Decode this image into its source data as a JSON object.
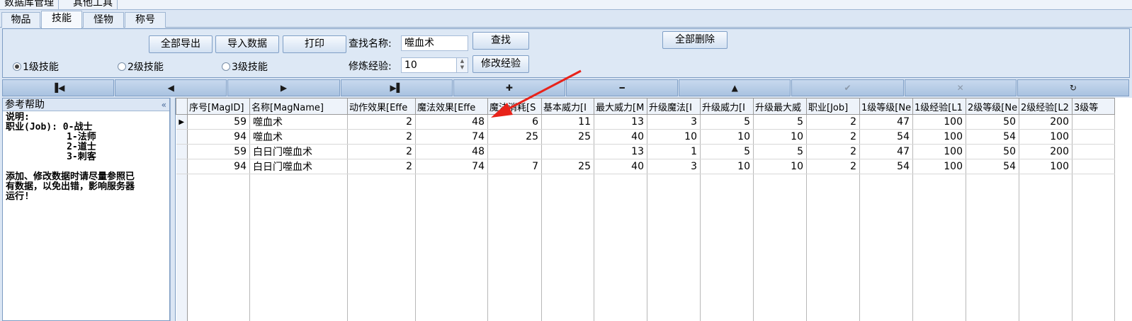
{
  "top_tabs": [
    "数据库管理",
    "其他工具"
  ],
  "tabs": [
    {
      "label": "物品",
      "active": false
    },
    {
      "label": "技能",
      "active": true
    },
    {
      "label": "怪物",
      "active": false
    },
    {
      "label": "称号",
      "active": false
    }
  ],
  "toolbar": {
    "export_all": "全部导出",
    "import_data": "导入数据",
    "print": "打印",
    "search_label": "查找名称:",
    "search_value": "噬血术",
    "search_button": "查找",
    "delete_all": "全部删除",
    "exp_label": "修炼经验:",
    "exp_value": "10",
    "modify_exp": "修改经验"
  },
  "radios": [
    {
      "label": "1级技能",
      "checked": true
    },
    {
      "label": "2级技能",
      "checked": false
    },
    {
      "label": "3级技能",
      "checked": false
    }
  ],
  "navigator": [
    {
      "icon": "first-record-icon",
      "glyph": "▐◀",
      "enabled": true
    },
    {
      "icon": "prior-record-icon",
      "glyph": "◀",
      "enabled": true
    },
    {
      "icon": "next-record-icon",
      "glyph": "▶",
      "enabled": true
    },
    {
      "icon": "last-record-icon",
      "glyph": "▶▌",
      "enabled": true
    },
    {
      "icon": "insert-record-icon",
      "glyph": "✚",
      "enabled": true
    },
    {
      "icon": "delete-record-icon",
      "glyph": "━",
      "enabled": true
    },
    {
      "icon": "edit-record-icon",
      "glyph": "▲",
      "enabled": true
    },
    {
      "icon": "post-edit-icon",
      "glyph": "✔",
      "enabled": false
    },
    {
      "icon": "cancel-edit-icon",
      "glyph": "✕",
      "enabled": false
    },
    {
      "icon": "refresh-data-icon",
      "glyph": "↻",
      "enabled": true
    }
  ],
  "help": {
    "title": "参考帮助",
    "text": "说明:\n职业(Job): 0-战士\n           1-法师\n           2-道士\n           3-刺客\n\n添加、修改数据时请尽量参照已\n有数据，以免出错，影响服务器\n运行!"
  },
  "grid": {
    "columns": [
      "序号[MagID]",
      "名称[MagName]",
      "动作效果[Effe",
      "魔法效果[Effe",
      "魔法消耗[S",
      "基本威力[I",
      "最大威力[M",
      "升级魔法[I",
      "升级威力[I",
      "升级最大威",
      "职业[Job]",
      "1级等级[Ne",
      "1级经验[L1",
      "2级等级[Ne",
      "2级经验[L2",
      "3级等"
    ],
    "rows": [
      [
        "59",
        "噬血术",
        "2",
        "48",
        "6",
        "11",
        "13",
        "3",
        "5",
        "5",
        "2",
        "47",
        "100",
        "50",
        "200",
        ""
      ],
      [
        "94",
        "噬血术",
        "2",
        "74",
        "25",
        "25",
        "40",
        "10",
        "10",
        "10",
        "2",
        "54",
        "100",
        "54",
        "100",
        ""
      ],
      [
        "59",
        "白日门噬血术",
        "2",
        "48",
        "",
        "",
        "13",
        "1",
        "5",
        "5",
        "2",
        "47",
        "100",
        "50",
        "200",
        ""
      ],
      [
        "94",
        "白日门噬血术",
        "2",
        "74",
        "7",
        "25",
        "40",
        "3",
        "10",
        "10",
        "2",
        "54",
        "100",
        "54",
        "100",
        ""
      ]
    ]
  }
}
